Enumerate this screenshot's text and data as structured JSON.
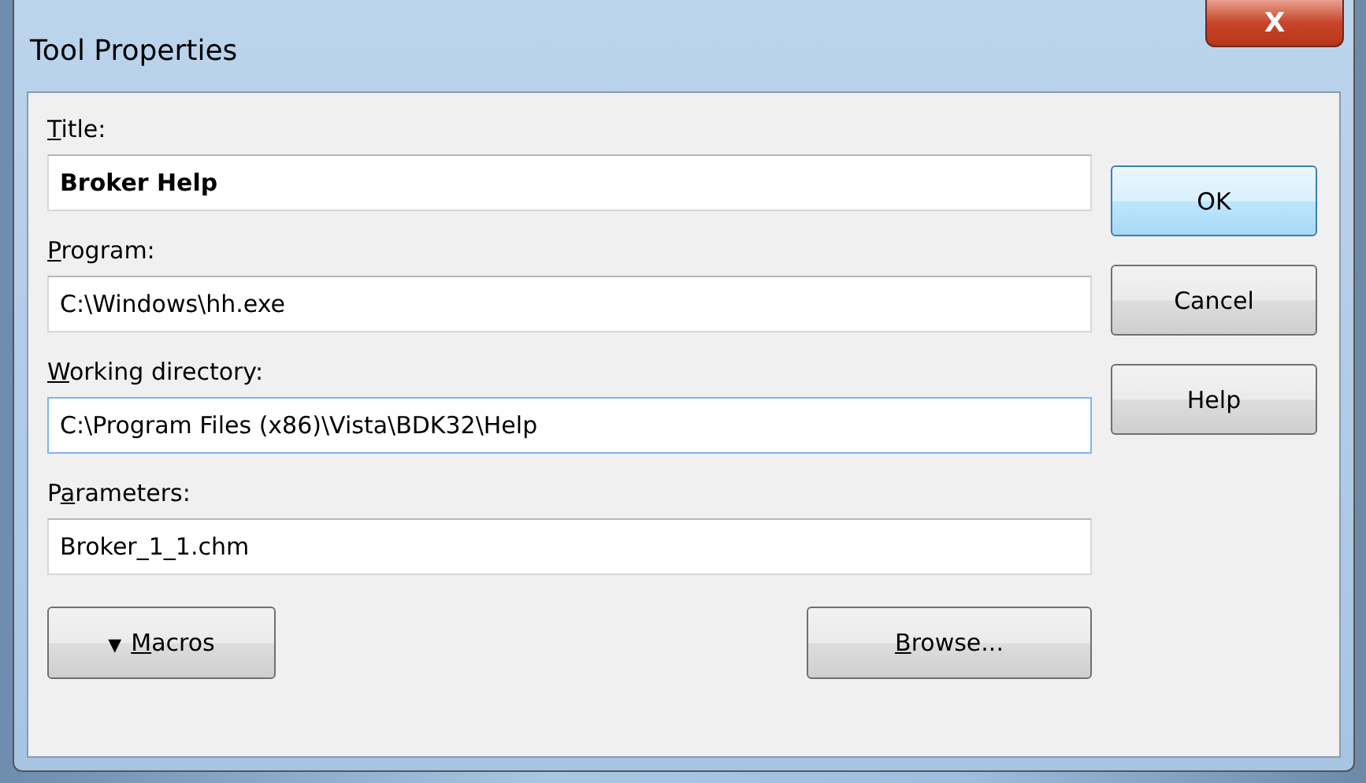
{
  "window": {
    "title": "Tool Properties",
    "close_icon": "X"
  },
  "fields": [
    {
      "label": {
        "key": "T",
        "post": "itle:"
      },
      "value": "Broker Help",
      "focused": false,
      "bold": true
    },
    {
      "label": {
        "key": "P",
        "post": "rogram:"
      },
      "value": "C:\\Windows\\hh.exe",
      "focused": false,
      "bold": false
    },
    {
      "label": {
        "key": "W",
        "post": "orking directory:"
      },
      "value": "C:\\Program Files (x86)\\Vista\\BDK32\\Help",
      "focused": true,
      "bold": false
    },
    {
      "label": {
        "pre": "P",
        "key": "a",
        "post": "rameters:"
      },
      "value": "Broker_1_1.chm",
      "focused": false,
      "bold": false
    }
  ],
  "side_buttons": [
    {
      "label": "OK",
      "default": true
    },
    {
      "label": "Cancel",
      "default": false
    },
    {
      "label": "Help",
      "default": false
    }
  ],
  "bottom_buttons": [
    {
      "kind": "menu",
      "arrow": "▼",
      "label": {
        "key": "M",
        "post": "acros"
      }
    },
    {
      "kind": "plain",
      "label": {
        "key": "B",
        "post": "rowse..."
      }
    }
  ]
}
